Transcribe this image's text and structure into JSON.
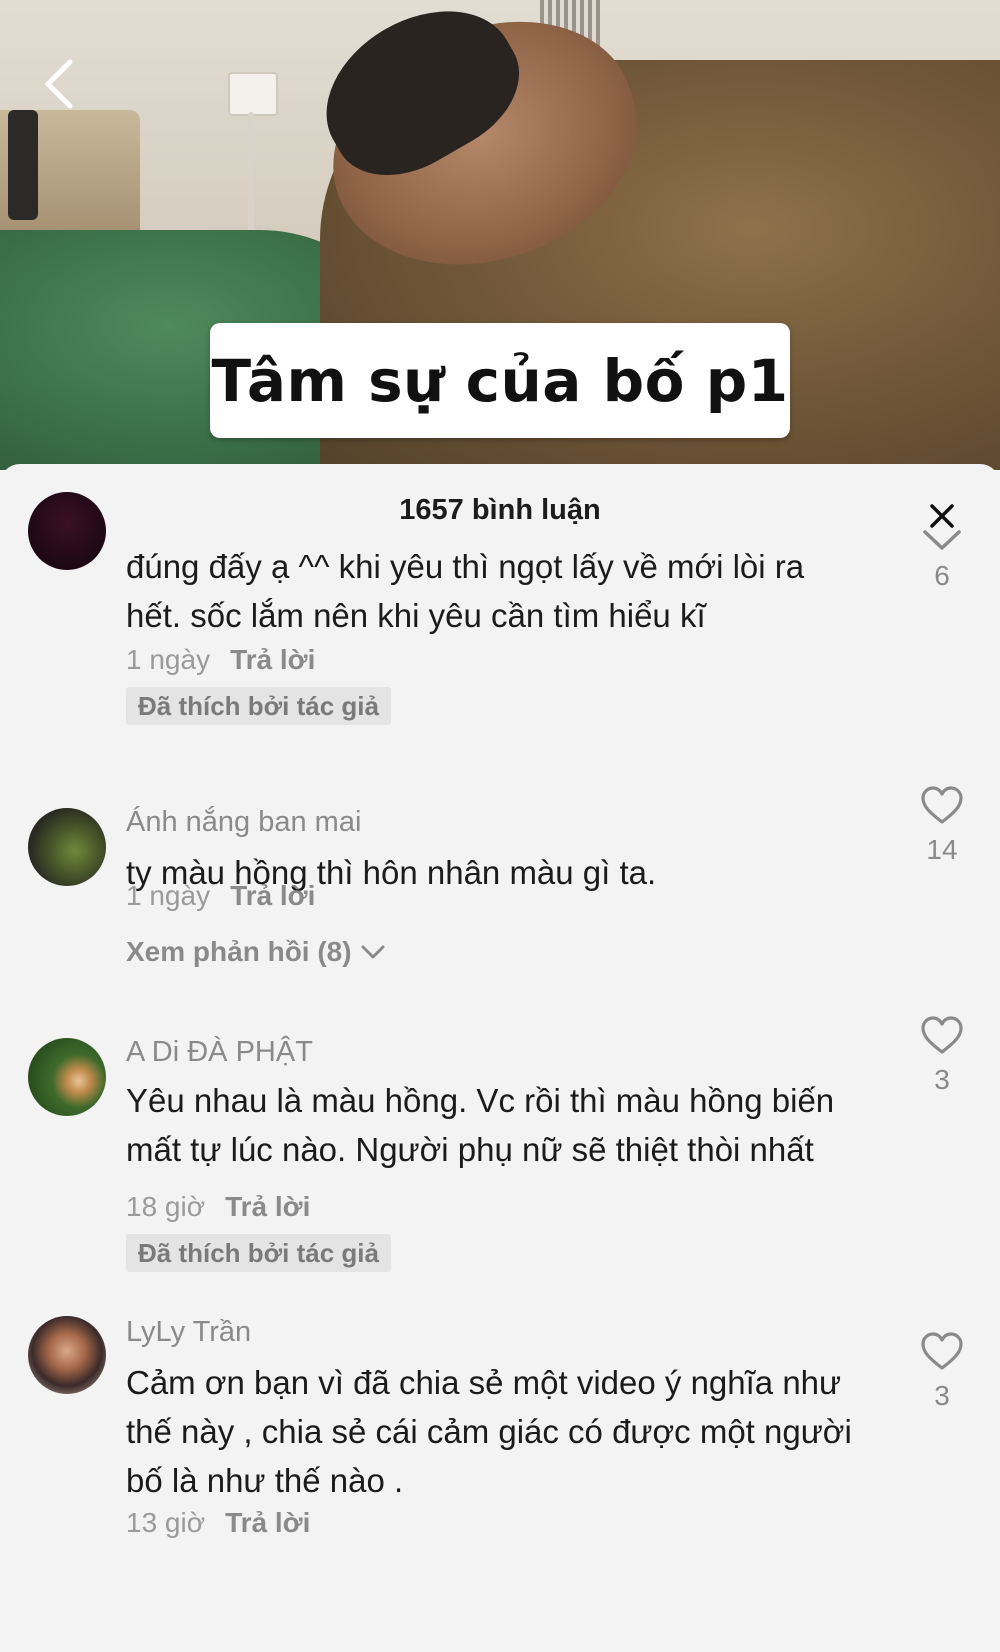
{
  "video": {
    "title_overlay": "Tâm sự của bố p1",
    "back_icon": "chevron-left-icon"
  },
  "comments_panel": {
    "header": "1657 bình luận",
    "close_icon": "close-icon",
    "comments": [
      {
        "username": "",
        "text": "đúng đấy ạ ^^ khi yêu thì ngọt lấy về mới lòi ra hết. sốc lắm nên khi yêu cần tìm hiểu kĩ",
        "time": "1 ngày",
        "reply": "Trả lời",
        "badge": "Đã thích bởi tác giả",
        "likes": "6",
        "like_icon": "chevron-down-icon"
      },
      {
        "username": "Ánh nắng ban mai",
        "text": "ty màu hồng thì hôn nhân màu gì ta.",
        "time": "1 ngày",
        "reply": "Trả lời",
        "view_replies": "Xem phản hồi (8)",
        "likes": "14",
        "like_icon": "heart-icon"
      },
      {
        "username": "A Di ĐÀ PHẬT",
        "text": "Yêu nhau là màu hồng. Vc rồi thì màu hồng biến mất tự lúc nào. Người phụ nữ sẽ thiệt thòi nhất",
        "time": "18 giờ",
        "reply": "Trả lời",
        "badge": "Đã thích bởi tác giả",
        "likes": "3",
        "like_icon": "heart-icon"
      },
      {
        "username": "LyLy Trần",
        "text": "Cảm ơn bạn vì đã chia sẻ một video ý nghĩa như thế này , chia sẻ cái cảm giác có được một người bố là như thế nào .",
        "time": "13 giờ",
        "reply": "Trả lời",
        "likes": "3",
        "like_icon": "heart-icon"
      }
    ]
  }
}
